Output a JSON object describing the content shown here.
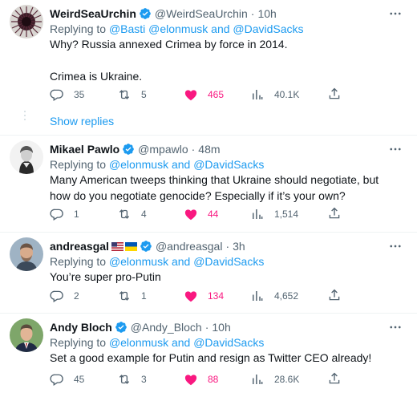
{
  "tweets": [
    {
      "name": "WeirdSeaUrchin",
      "handle": "@WeirdSeaUrchin",
      "time": "10h",
      "reply_prefix": "Replying to",
      "mentions": "@Basti @elonmusk and @DavidSacks",
      "text_lines": [
        "Why? Russia annexed Crimea by force in 2014.",
        "Crimea is Ukraine."
      ],
      "replies": "35",
      "retweets": "5",
      "likes": "465",
      "views": "40.1K"
    },
    {
      "name": "Mikael Pawlo",
      "handle": "@mpawlo",
      "time": "48m",
      "reply_prefix": "Replying to",
      "mentions": "@elonmusk and @DavidSacks",
      "text_lines": [
        "Many American tweeps thinking that Ukraine should negotiate, but how do you negotiate genocide? Especially if it’s your own?"
      ],
      "replies": "1",
      "retweets": "4",
      "likes": "44",
      "views": "1,514"
    },
    {
      "name": "andreasgal",
      "handle": "@andreasgal",
      "time": "3h",
      "reply_prefix": "Replying to",
      "mentions": "@elonmusk and @DavidSacks",
      "text_lines": [
        "You’re super pro-Putin"
      ],
      "replies": "2",
      "retweets": "1",
      "likes": "134",
      "views": "4,652"
    },
    {
      "name": "Andy Bloch",
      "handle": "@Andy_Bloch",
      "time": "10h",
      "reply_prefix": "Replying to",
      "mentions": "@elonmusk and @DavidSacks",
      "text_lines": [
        "Set a good example for Putin and resign as Twitter CEO already!"
      ],
      "replies": "45",
      "retweets": "3",
      "likes": "88",
      "views": "28.6K"
    }
  ],
  "show_replies_label": "Show replies",
  "separator": "·",
  "icons": {
    "verified": "verified-badge-icon",
    "more": "more-options-icon",
    "reply": "reply-icon",
    "retweet": "retweet-icon",
    "like": "heart-filled-icon",
    "views": "views-bar-chart-icon",
    "share": "share-icon"
  },
  "colors": {
    "accent": "#1d9bf0",
    "like": "#f91880",
    "muted": "#536471",
    "text": "#0f1419",
    "divider": "#eff3f4"
  }
}
